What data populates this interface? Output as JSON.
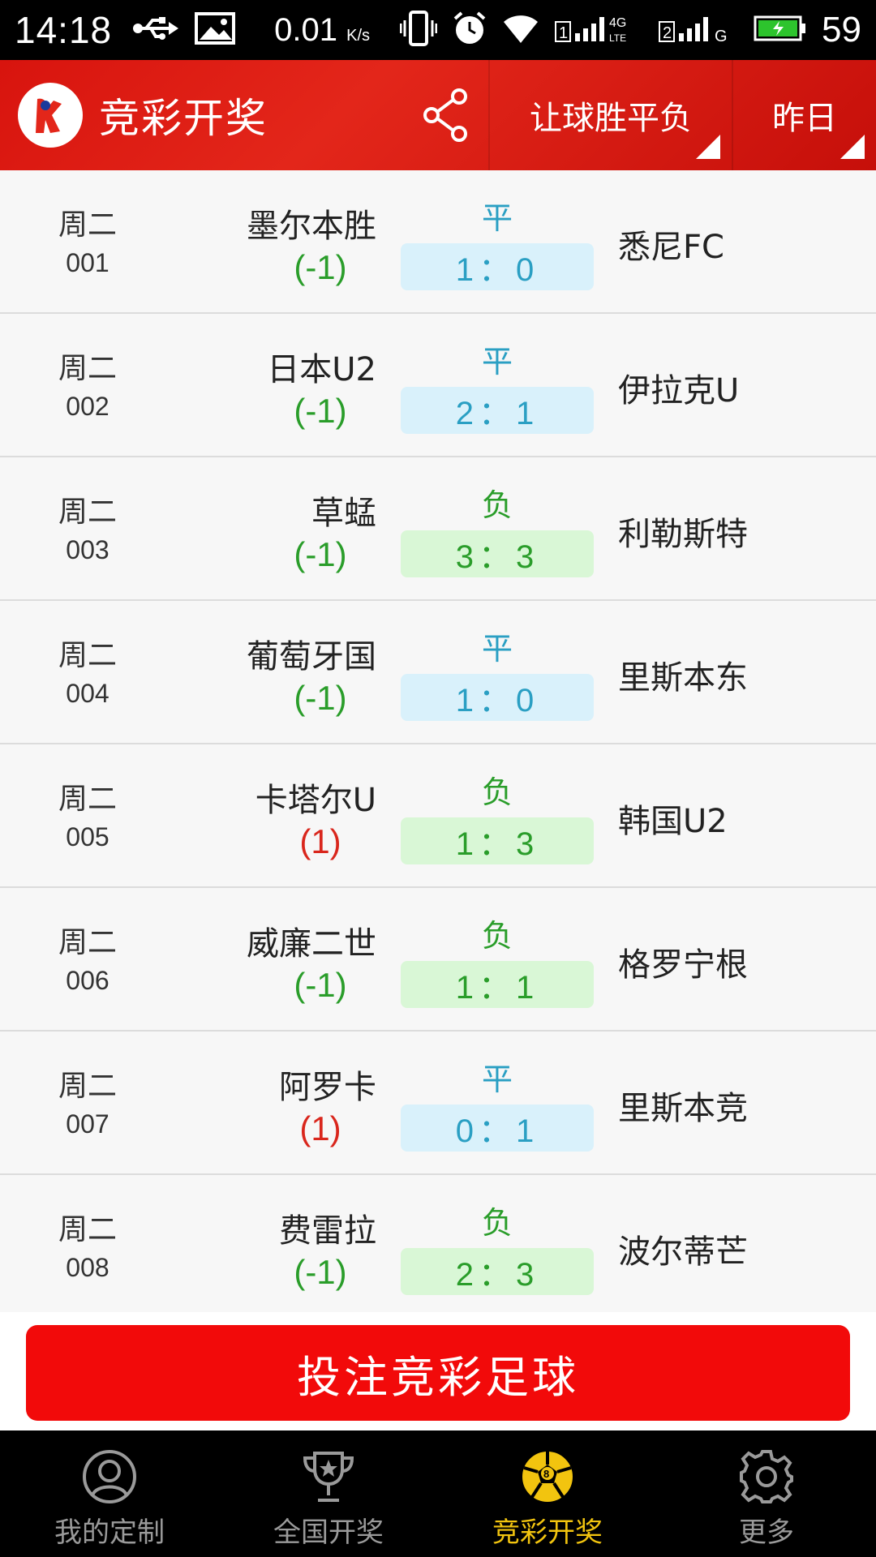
{
  "status_bar": {
    "time": "14:18",
    "speed": "0.01",
    "speed_unit": "K/s",
    "battery": "59",
    "network1": "4G LTE",
    "network2": "G",
    "sim1": "1",
    "sim2": "2"
  },
  "header": {
    "title": "竞彩开奖",
    "play_type": "让球胜平负",
    "date_filter": "昨日"
  },
  "matches": [
    {
      "day": "周二",
      "num": "001",
      "home": "墨尔本胜",
      "handicap": "(-1)",
      "handicap_type": "neg",
      "result": "平",
      "result_type": "draw",
      "score": "1：0",
      "away": "悉尼FC"
    },
    {
      "day": "周二",
      "num": "002",
      "home": "日本U2",
      "handicap": "(-1)",
      "handicap_type": "neg",
      "result": "平",
      "result_type": "draw",
      "score": "2：1",
      "away": "伊拉克U"
    },
    {
      "day": "周二",
      "num": "003",
      "home": "草蜢",
      "handicap": "(-1)",
      "handicap_type": "neg",
      "result": "负",
      "result_type": "lose",
      "score": "3：3",
      "away": "利勒斯特"
    },
    {
      "day": "周二",
      "num": "004",
      "home": "葡萄牙国",
      "handicap": "(-1)",
      "handicap_type": "neg",
      "result": "平",
      "result_type": "draw",
      "score": "1：0",
      "away": "里斯本东"
    },
    {
      "day": "周二",
      "num": "005",
      "home": "卡塔尔U",
      "handicap": "(1)",
      "handicap_type": "pos",
      "result": "负",
      "result_type": "lose",
      "score": "1：3",
      "away": "韩国U2"
    },
    {
      "day": "周二",
      "num": "006",
      "home": "威廉二世",
      "handicap": "(-1)",
      "handicap_type": "neg",
      "result": "负",
      "result_type": "lose",
      "score": "1：1",
      "away": "格罗宁根"
    },
    {
      "day": "周二",
      "num": "007",
      "home": "阿罗卡",
      "handicap": "(1)",
      "handicap_type": "pos",
      "result": "平",
      "result_type": "draw",
      "score": "0：1",
      "away": "里斯本竞"
    },
    {
      "day": "周二",
      "num": "008",
      "home": "费雷拉",
      "handicap": "(-1)",
      "handicap_type": "neg",
      "result": "负",
      "result_type": "lose",
      "score": "2：3",
      "away": "波尔蒂芒"
    }
  ],
  "bet_button": "投注竞彩足球",
  "nav": [
    {
      "label": "我的定制",
      "icon": "user-icon",
      "active": false
    },
    {
      "label": "全国开奖",
      "icon": "trophy-icon",
      "active": false
    },
    {
      "label": "竞彩开奖",
      "icon": "football-icon",
      "active": true
    },
    {
      "label": "更多",
      "icon": "gear-icon",
      "active": false
    }
  ],
  "colors": {
    "header_red": "#d8140e",
    "bet_red": "#f20a0a",
    "draw_blue": "#2a9fc3",
    "lose_green": "#2a9d2a",
    "positive_red": "#d9261c",
    "nav_active": "#f2c40f"
  }
}
